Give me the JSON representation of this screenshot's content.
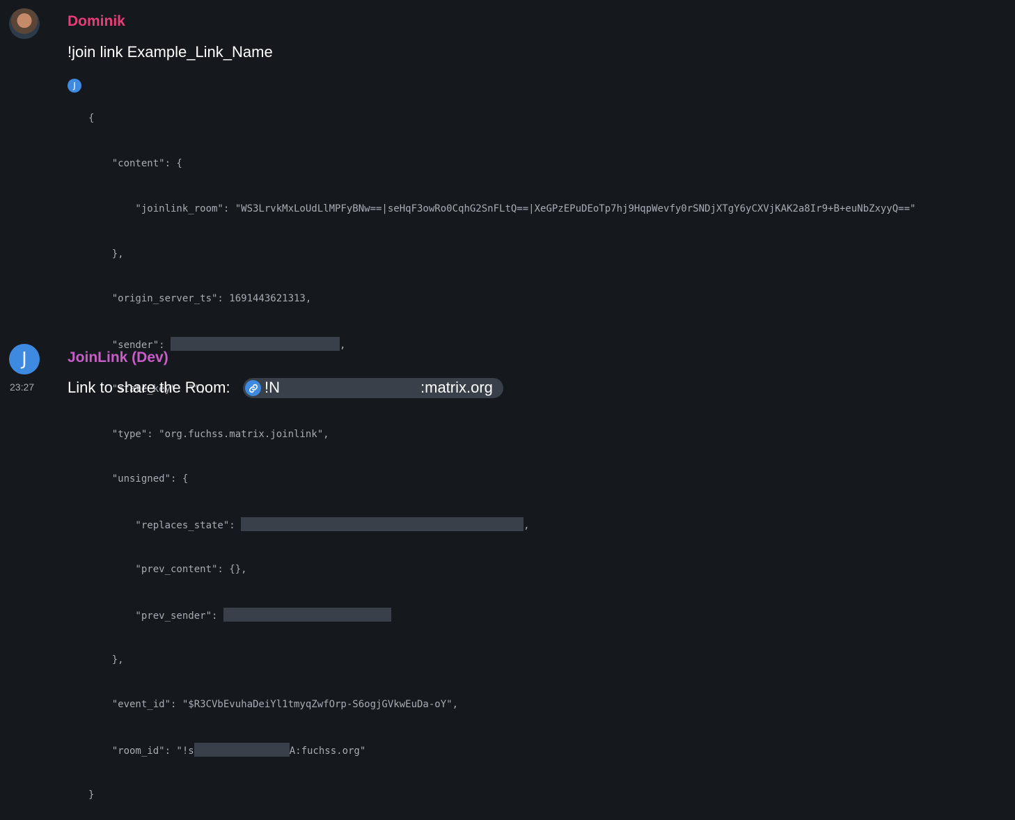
{
  "message1": {
    "sender": "Dominik",
    "sender_color": "#ea3d78",
    "avatar_icon": "user-photo-avatar",
    "body": "!join link Example_Link_Name",
    "reaction_avatar_letter": "J",
    "json_lines": [
      "{",
      "    \"content\": {",
      "        \"joinlink_room\": \"WS3LrvkMxLoUdLlMPFyBNw==|seHqF3owRo0CqhG2SnFLtQ==|XeGPzEPuDEoTp7hj9HqpWevfy0rSNDjXTgY6yCXVjKAK2a8Ir9+B+euNbZxyyQ==\"",
      "    },",
      "    \"origin_server_ts\": 1691443621313,",
      "    \"sender\": ",
      "    \"state_key\": \"\",",
      "    \"type\": \"org.fuchss.matrix.joinlink\",",
      "    \"unsigned\": {",
      "        \"replaces_state\": ",
      "        \"prev_content\": {},",
      "        \"prev_sender\": ",
      "    },",
      "    \"event_id\": \"$R3CVbEvuhaDeiYl1tmyqZwfOrp-S6ogjGVkwEuDa-oY\",",
      "    \"room_id\": \"!s",
      "}"
    ],
    "json_suffixes": {
      "sender": ",",
      "replaces_state": ",",
      "room_id": "A:fuchss.org\""
    }
  },
  "message2": {
    "sender": "JoinLink (Dev)",
    "sender_color": "#c95cc9",
    "avatar_letter": "J",
    "timestamp": "23:27",
    "body_prefix": "Link to share the Room: ",
    "pill_prefix": "!N",
    "pill_suffix": ":matrix.org",
    "pill_icon": "link-icon"
  }
}
